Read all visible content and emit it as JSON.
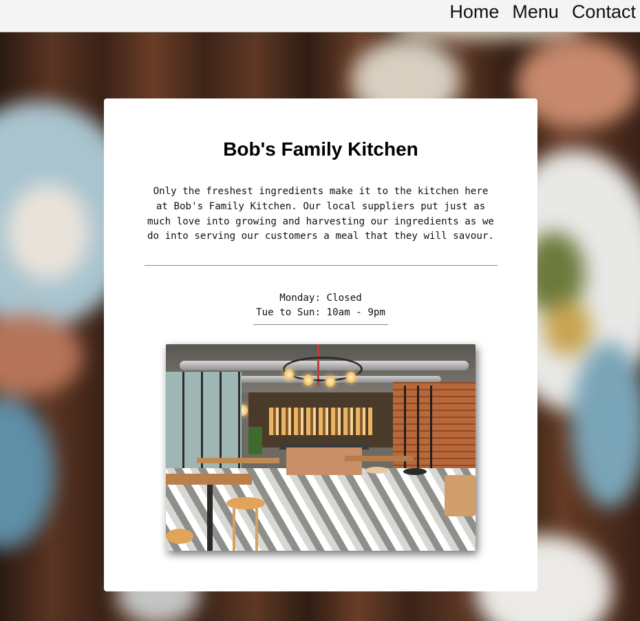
{
  "nav": {
    "links": [
      "Home",
      "Menu",
      "Contact"
    ]
  },
  "card": {
    "title": "Bob's Family Kitchen",
    "intro": "Only the freshest ingredients make it to the kitchen here at Bob's Family Kitchen. Our local suppliers put just as much love into growing and harvesting our ingredients as we do into serving our customers a meal that they will savour.",
    "hours": {
      "line1": "Monday: Closed",
      "line2": "Tue to Sun: 10am - 9pm"
    }
  },
  "colors": {
    "navbar_bg": "#f4f4f4",
    "card_bg": "#ffffff",
    "text": "#111111"
  }
}
